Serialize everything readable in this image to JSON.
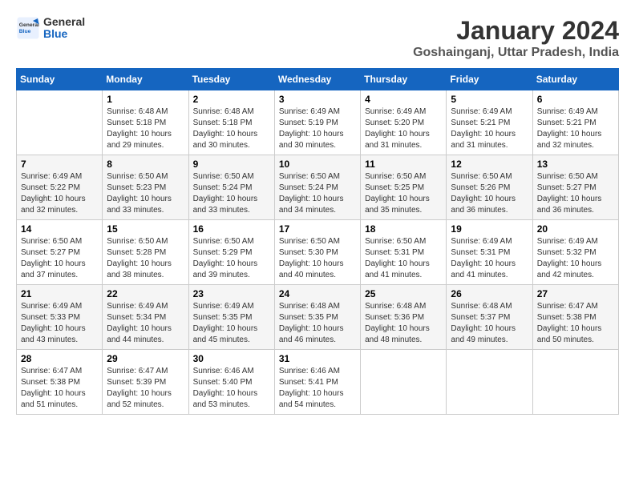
{
  "logo": {
    "general": "General",
    "blue": "Blue"
  },
  "header": {
    "month": "January 2024",
    "location": "Goshainganj, Uttar Pradesh, India"
  },
  "weekdays": [
    "Sunday",
    "Monday",
    "Tuesday",
    "Wednesday",
    "Thursday",
    "Friday",
    "Saturday"
  ],
  "weeks": [
    [
      {
        "day": "",
        "sunrise": "",
        "sunset": "",
        "daylight": ""
      },
      {
        "day": "1",
        "sunrise": "Sunrise: 6:48 AM",
        "sunset": "Sunset: 5:18 PM",
        "daylight": "Daylight: 10 hours and 29 minutes."
      },
      {
        "day": "2",
        "sunrise": "Sunrise: 6:48 AM",
        "sunset": "Sunset: 5:18 PM",
        "daylight": "Daylight: 10 hours and 30 minutes."
      },
      {
        "day": "3",
        "sunrise": "Sunrise: 6:49 AM",
        "sunset": "Sunset: 5:19 PM",
        "daylight": "Daylight: 10 hours and 30 minutes."
      },
      {
        "day": "4",
        "sunrise": "Sunrise: 6:49 AM",
        "sunset": "Sunset: 5:20 PM",
        "daylight": "Daylight: 10 hours and 31 minutes."
      },
      {
        "day": "5",
        "sunrise": "Sunrise: 6:49 AM",
        "sunset": "Sunset: 5:21 PM",
        "daylight": "Daylight: 10 hours and 31 minutes."
      },
      {
        "day": "6",
        "sunrise": "Sunrise: 6:49 AM",
        "sunset": "Sunset: 5:21 PM",
        "daylight": "Daylight: 10 hours and 32 minutes."
      }
    ],
    [
      {
        "day": "7",
        "sunrise": "Sunrise: 6:49 AM",
        "sunset": "Sunset: 5:22 PM",
        "daylight": "Daylight: 10 hours and 32 minutes."
      },
      {
        "day": "8",
        "sunrise": "Sunrise: 6:50 AM",
        "sunset": "Sunset: 5:23 PM",
        "daylight": "Daylight: 10 hours and 33 minutes."
      },
      {
        "day": "9",
        "sunrise": "Sunrise: 6:50 AM",
        "sunset": "Sunset: 5:24 PM",
        "daylight": "Daylight: 10 hours and 33 minutes."
      },
      {
        "day": "10",
        "sunrise": "Sunrise: 6:50 AM",
        "sunset": "Sunset: 5:24 PM",
        "daylight": "Daylight: 10 hours and 34 minutes."
      },
      {
        "day": "11",
        "sunrise": "Sunrise: 6:50 AM",
        "sunset": "Sunset: 5:25 PM",
        "daylight": "Daylight: 10 hours and 35 minutes."
      },
      {
        "day": "12",
        "sunrise": "Sunrise: 6:50 AM",
        "sunset": "Sunset: 5:26 PM",
        "daylight": "Daylight: 10 hours and 36 minutes."
      },
      {
        "day": "13",
        "sunrise": "Sunrise: 6:50 AM",
        "sunset": "Sunset: 5:27 PM",
        "daylight": "Daylight: 10 hours and 36 minutes."
      }
    ],
    [
      {
        "day": "14",
        "sunrise": "Sunrise: 6:50 AM",
        "sunset": "Sunset: 5:27 PM",
        "daylight": "Daylight: 10 hours and 37 minutes."
      },
      {
        "day": "15",
        "sunrise": "Sunrise: 6:50 AM",
        "sunset": "Sunset: 5:28 PM",
        "daylight": "Daylight: 10 hours and 38 minutes."
      },
      {
        "day": "16",
        "sunrise": "Sunrise: 6:50 AM",
        "sunset": "Sunset: 5:29 PM",
        "daylight": "Daylight: 10 hours and 39 minutes."
      },
      {
        "day": "17",
        "sunrise": "Sunrise: 6:50 AM",
        "sunset": "Sunset: 5:30 PM",
        "daylight": "Daylight: 10 hours and 40 minutes."
      },
      {
        "day": "18",
        "sunrise": "Sunrise: 6:50 AM",
        "sunset": "Sunset: 5:31 PM",
        "daylight": "Daylight: 10 hours and 41 minutes."
      },
      {
        "day": "19",
        "sunrise": "Sunrise: 6:49 AM",
        "sunset": "Sunset: 5:31 PM",
        "daylight": "Daylight: 10 hours and 41 minutes."
      },
      {
        "day": "20",
        "sunrise": "Sunrise: 6:49 AM",
        "sunset": "Sunset: 5:32 PM",
        "daylight": "Daylight: 10 hours and 42 minutes."
      }
    ],
    [
      {
        "day": "21",
        "sunrise": "Sunrise: 6:49 AM",
        "sunset": "Sunset: 5:33 PM",
        "daylight": "Daylight: 10 hours and 43 minutes."
      },
      {
        "day": "22",
        "sunrise": "Sunrise: 6:49 AM",
        "sunset": "Sunset: 5:34 PM",
        "daylight": "Daylight: 10 hours and 44 minutes."
      },
      {
        "day": "23",
        "sunrise": "Sunrise: 6:49 AM",
        "sunset": "Sunset: 5:35 PM",
        "daylight": "Daylight: 10 hours and 45 minutes."
      },
      {
        "day": "24",
        "sunrise": "Sunrise: 6:48 AM",
        "sunset": "Sunset: 5:35 PM",
        "daylight": "Daylight: 10 hours and 46 minutes."
      },
      {
        "day": "25",
        "sunrise": "Sunrise: 6:48 AM",
        "sunset": "Sunset: 5:36 PM",
        "daylight": "Daylight: 10 hours and 48 minutes."
      },
      {
        "day": "26",
        "sunrise": "Sunrise: 6:48 AM",
        "sunset": "Sunset: 5:37 PM",
        "daylight": "Daylight: 10 hours and 49 minutes."
      },
      {
        "day": "27",
        "sunrise": "Sunrise: 6:47 AM",
        "sunset": "Sunset: 5:38 PM",
        "daylight": "Daylight: 10 hours and 50 minutes."
      }
    ],
    [
      {
        "day": "28",
        "sunrise": "Sunrise: 6:47 AM",
        "sunset": "Sunset: 5:38 PM",
        "daylight": "Daylight: 10 hours and 51 minutes."
      },
      {
        "day": "29",
        "sunrise": "Sunrise: 6:47 AM",
        "sunset": "Sunset: 5:39 PM",
        "daylight": "Daylight: 10 hours and 52 minutes."
      },
      {
        "day": "30",
        "sunrise": "Sunrise: 6:46 AM",
        "sunset": "Sunset: 5:40 PM",
        "daylight": "Daylight: 10 hours and 53 minutes."
      },
      {
        "day": "31",
        "sunrise": "Sunrise: 6:46 AM",
        "sunset": "Sunset: 5:41 PM",
        "daylight": "Daylight: 10 hours and 54 minutes."
      },
      {
        "day": "",
        "sunrise": "",
        "sunset": "",
        "daylight": ""
      },
      {
        "day": "",
        "sunrise": "",
        "sunset": "",
        "daylight": ""
      },
      {
        "day": "",
        "sunrise": "",
        "sunset": "",
        "daylight": ""
      }
    ]
  ]
}
